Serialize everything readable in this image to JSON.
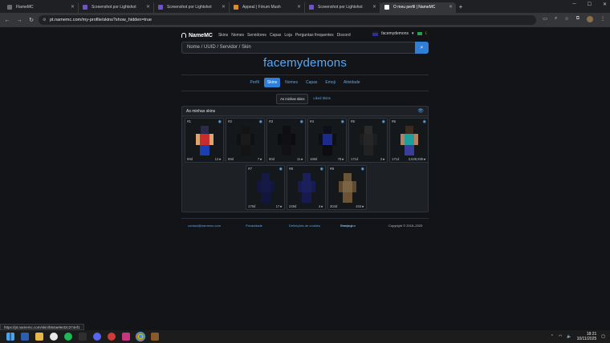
{
  "browser": {
    "tabs": [
      {
        "label": "FlameMC",
        "fav": "flame"
      },
      {
        "label": "Screenshot por Lightshot",
        "fav": "ls"
      },
      {
        "label": "Screenshot por Lightshot",
        "fav": "ls"
      },
      {
        "label": "Appeal | Fórum Mush",
        "fav": "fm"
      },
      {
        "label": "Screenshot por Lightshot",
        "fav": "ls"
      },
      {
        "label": "O meu perfil | NameMC",
        "fav": "nm",
        "active": true
      }
    ],
    "new_tab": "+",
    "url": "pt.namemc.com/my-profile/skins?show_hidden=true"
  },
  "namemc": {
    "brand": "NameMC",
    "nav": [
      "Skins",
      "Nomes",
      "Servidores",
      "Capas",
      "Loja",
      "Perguntas frequentes",
      "Discord"
    ],
    "user": "facemydemons",
    "search_placeholder": "Nome / UUID / Servidor / Skin",
    "profile_name": "facemydemons",
    "profile_tabs": [
      {
        "label": "Perfil"
      },
      {
        "label": "Skins",
        "active": true
      },
      {
        "label": "Nomes"
      },
      {
        "label": "Capas"
      },
      {
        "label": "Emoji"
      },
      {
        "label": "Atividade"
      }
    ],
    "sub_tabs": [
      {
        "label": "As minhas skins",
        "active": true
      },
      {
        "label": "Liked Skins"
      }
    ],
    "panel_title": "As minhas skins",
    "skins": [
      {
        "num": "#1",
        "age": "89d",
        "stars": "12★",
        "colors": {
          "head": "#2b2a4a",
          "body": "#c82d2d",
          "arm": "#d9a66b",
          "leg": "#1a3fb0"
        }
      },
      {
        "num": "#2",
        "age": "89d",
        "stars": "7★",
        "colors": {
          "head": "#141414",
          "body": "#1a1a1a",
          "arm": "#111111",
          "leg": "#141414"
        }
      },
      {
        "num": "#3",
        "age": "90d",
        "stars": "11★",
        "colors": {
          "head": "#0f0f12",
          "body": "#101014",
          "arm": "#0d0d10",
          "leg": "#121216"
        }
      },
      {
        "num": "#4",
        "age": "168d",
        "stars": "78★",
        "colors": {
          "head": "#0d0f1c",
          "body": "#1c2a8c",
          "arm": "#101014",
          "leg": "#0d0d10"
        }
      },
      {
        "num": "#5",
        "age": "171d",
        "stars": "2★",
        "colors": {
          "head": "#2a2a2a",
          "body": "#262626",
          "arm": "#1e1e1e",
          "leg": "#222222"
        }
      },
      {
        "num": "#6",
        "age": "171d",
        "stars": "3,638,935★",
        "colors": {
          "head": "#3c2a1c",
          "body": "#1f9e9e",
          "arm": "#b9805e",
          "leg": "#3b3d9b"
        }
      },
      {
        "num": "#7",
        "age": "178d",
        "stars": "17★",
        "colors": {
          "head": "#151a45",
          "body": "#151a45",
          "arm": "#131740",
          "leg": "#12163c"
        }
      },
      {
        "num": "#8",
        "age": "249d",
        "stars": "4★",
        "colors": {
          "head": "#1b1f5a",
          "body": "#1b1f5a",
          "arm": "#181c54",
          "leg": "#161a4e"
        }
      },
      {
        "num": "#9",
        "age": "304d",
        "stars": "404★",
        "colors": {
          "head": "#6b5436",
          "body": "#7a6444",
          "arm": "#5e4a30",
          "leg": "#6b5436"
        }
      }
    ],
    "footer": {
      "email": "contact@namemc.com",
      "privacy": "Privacidade",
      "cookies": "Definições de cookies",
      "made_in_prefix": "Emojis por ",
      "made_in_link": "Twemoji",
      "copyright": "Copyright © 2015–2025"
    }
  },
  "status_url": "https://pt.namemc.com/skin/b84ae9e32c374ef1",
  "taskbar": {
    "time": "18:21",
    "date": "10/11/2025"
  },
  "colors": {
    "accent": "#2f7fd6",
    "link": "#5aa8f0"
  }
}
